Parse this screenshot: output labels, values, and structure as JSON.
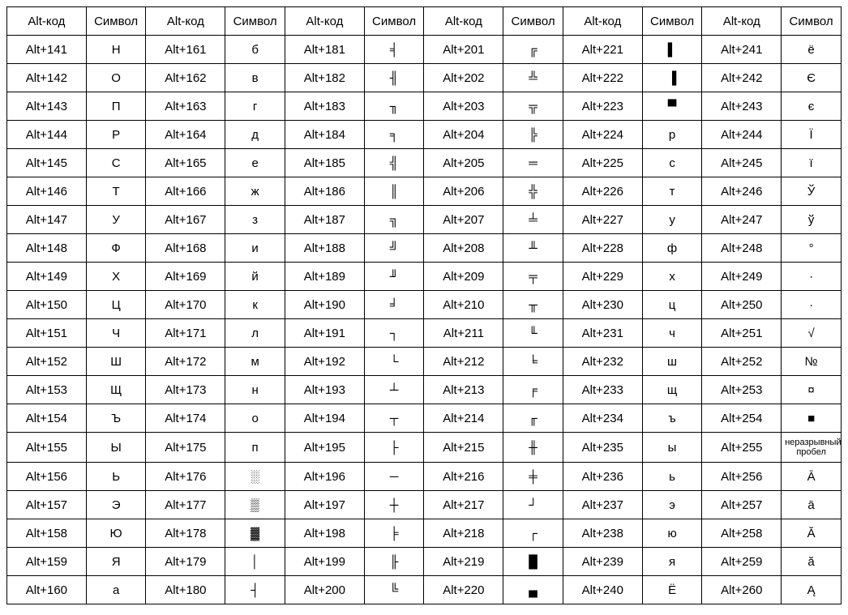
{
  "headers": {
    "code": "Alt-код",
    "symbol": "Символ"
  },
  "columns": [
    [
      {
        "code": "Alt+141",
        "sym": "Н"
      },
      {
        "code": "Alt+142",
        "sym": "О"
      },
      {
        "code": "Alt+143",
        "sym": "П"
      },
      {
        "code": "Alt+144",
        "sym": "Р"
      },
      {
        "code": "Alt+145",
        "sym": "С"
      },
      {
        "code": "Alt+146",
        "sym": "Т"
      },
      {
        "code": "Alt+147",
        "sym": "У"
      },
      {
        "code": "Alt+148",
        "sym": "Ф"
      },
      {
        "code": "Alt+149",
        "sym": "Х"
      },
      {
        "code": "Alt+150",
        "sym": "Ц"
      },
      {
        "code": "Alt+151",
        "sym": "Ч"
      },
      {
        "code": "Alt+152",
        "sym": "Ш"
      },
      {
        "code": "Alt+153",
        "sym": "Щ"
      },
      {
        "code": "Alt+154",
        "sym": "Ъ"
      },
      {
        "code": "Alt+155",
        "sym": "Ы"
      },
      {
        "code": "Alt+156",
        "sym": "Ь"
      },
      {
        "code": "Alt+157",
        "sym": "Э"
      },
      {
        "code": "Alt+158",
        "sym": "Ю"
      },
      {
        "code": "Alt+159",
        "sym": "Я"
      },
      {
        "code": "Alt+160",
        "sym": "а"
      }
    ],
    [
      {
        "code": "Alt+161",
        "sym": "б"
      },
      {
        "code": "Alt+162",
        "sym": "в"
      },
      {
        "code": "Alt+163",
        "sym": "г"
      },
      {
        "code": "Alt+164",
        "sym": "д"
      },
      {
        "code": "Alt+165",
        "sym": "е"
      },
      {
        "code": "Alt+166",
        "sym": "ж"
      },
      {
        "code": "Alt+167",
        "sym": "з"
      },
      {
        "code": "Alt+168",
        "sym": "и"
      },
      {
        "code": "Alt+169",
        "sym": "й"
      },
      {
        "code": "Alt+170",
        "sym": "к"
      },
      {
        "code": "Alt+171",
        "sym": "л"
      },
      {
        "code": "Alt+172",
        "sym": "м"
      },
      {
        "code": "Alt+173",
        "sym": "н"
      },
      {
        "code": "Alt+174",
        "sym": "о"
      },
      {
        "code": "Alt+175",
        "sym": "п"
      },
      {
        "code": "Alt+176",
        "sym": "░"
      },
      {
        "code": "Alt+177",
        "sym": "▒"
      },
      {
        "code": "Alt+178",
        "sym": "▓"
      },
      {
        "code": "Alt+179",
        "sym": "│"
      },
      {
        "code": "Alt+180",
        "sym": "┤"
      }
    ],
    [
      {
        "code": "Alt+181",
        "sym": "╡"
      },
      {
        "code": "Alt+182",
        "sym": "╢"
      },
      {
        "code": "Alt+183",
        "sym": "╖"
      },
      {
        "code": "Alt+184",
        "sym": "╕"
      },
      {
        "code": "Alt+185",
        "sym": "╣"
      },
      {
        "code": "Alt+186",
        "sym": "║"
      },
      {
        "code": "Alt+187",
        "sym": "╗"
      },
      {
        "code": "Alt+188",
        "sym": "╝"
      },
      {
        "code": "Alt+189",
        "sym": "╜"
      },
      {
        "code": "Alt+190",
        "sym": "╛"
      },
      {
        "code": "Alt+191",
        "sym": "┐"
      },
      {
        "code": "Alt+192",
        "sym": "└"
      },
      {
        "code": "Alt+193",
        "sym": "┴"
      },
      {
        "code": "Alt+194",
        "sym": "┬"
      },
      {
        "code": "Alt+195",
        "sym": "├"
      },
      {
        "code": "Alt+196",
        "sym": "─"
      },
      {
        "code": "Alt+197",
        "sym": "┼"
      },
      {
        "code": "Alt+198",
        "sym": "╞"
      },
      {
        "code": "Alt+199",
        "sym": "╟"
      },
      {
        "code": "Alt+200",
        "sym": "╚"
      }
    ],
    [
      {
        "code": "Alt+201",
        "sym": "╔"
      },
      {
        "code": "Alt+202",
        "sym": "╩"
      },
      {
        "code": "Alt+203",
        "sym": "╦"
      },
      {
        "code": "Alt+204",
        "sym": "╠"
      },
      {
        "code": "Alt+205",
        "sym": "═"
      },
      {
        "code": "Alt+206",
        "sym": "╬"
      },
      {
        "code": "Alt+207",
        "sym": "╧"
      },
      {
        "code": "Alt+208",
        "sym": "╨"
      },
      {
        "code": "Alt+209",
        "sym": "╤"
      },
      {
        "code": "Alt+210",
        "sym": "╥"
      },
      {
        "code": "Alt+211",
        "sym": "╙"
      },
      {
        "code": "Alt+212",
        "sym": "╘"
      },
      {
        "code": "Alt+213",
        "sym": "╒"
      },
      {
        "code": "Alt+214",
        "sym": "╓"
      },
      {
        "code": "Alt+215",
        "sym": "╫"
      },
      {
        "code": "Alt+216",
        "sym": "╪"
      },
      {
        "code": "Alt+217",
        "sym": "┘"
      },
      {
        "code": "Alt+218",
        "sym": "┌"
      },
      {
        "code": "Alt+219",
        "sym": "█"
      },
      {
        "code": "Alt+220",
        "sym": "▄"
      }
    ],
    [
      {
        "code": "Alt+221",
        "sym": "▌"
      },
      {
        "code": "Alt+222",
        "sym": "▐"
      },
      {
        "code": "Alt+223",
        "sym": "▀"
      },
      {
        "code": "Alt+224",
        "sym": "р"
      },
      {
        "code": "Alt+225",
        "sym": "с"
      },
      {
        "code": "Alt+226",
        "sym": "т"
      },
      {
        "code": "Alt+227",
        "sym": "у"
      },
      {
        "code": "Alt+228",
        "sym": "ф"
      },
      {
        "code": "Alt+229",
        "sym": "х"
      },
      {
        "code": "Alt+230",
        "sym": "ц"
      },
      {
        "code": "Alt+231",
        "sym": "ч"
      },
      {
        "code": "Alt+232",
        "sym": "ш"
      },
      {
        "code": "Alt+233",
        "sym": "щ"
      },
      {
        "code": "Alt+234",
        "sym": "ъ"
      },
      {
        "code": "Alt+235",
        "sym": "ы"
      },
      {
        "code": "Alt+236",
        "sym": "ь"
      },
      {
        "code": "Alt+237",
        "sym": "э"
      },
      {
        "code": "Alt+238",
        "sym": "ю"
      },
      {
        "code": "Alt+239",
        "sym": "я"
      },
      {
        "code": "Alt+240",
        "sym": "Ё"
      }
    ],
    [
      {
        "code": "Alt+241",
        "sym": "ё"
      },
      {
        "code": "Alt+242",
        "sym": "Є"
      },
      {
        "code": "Alt+243",
        "sym": "є"
      },
      {
        "code": "Alt+244",
        "sym": "Ї"
      },
      {
        "code": "Alt+245",
        "sym": "ї"
      },
      {
        "code": "Alt+246",
        "sym": "Ў"
      },
      {
        "code": "Alt+247",
        "sym": "ў"
      },
      {
        "code": "Alt+248",
        "sym": "°"
      },
      {
        "code": "Alt+249",
        "sym": "∙"
      },
      {
        "code": "Alt+250",
        "sym": "·"
      },
      {
        "code": "Alt+251",
        "sym": "√"
      },
      {
        "code": "Alt+252",
        "sym": "№"
      },
      {
        "code": "Alt+253",
        "sym": "¤"
      },
      {
        "code": "Alt+254",
        "sym": "■"
      },
      {
        "code": "Alt+255",
        "sym": "неразрывный пробел",
        "small": true
      },
      {
        "code": "Alt+256",
        "sym": "Ā"
      },
      {
        "code": "Alt+257",
        "sym": "ā"
      },
      {
        "code": "Alt+258",
        "sym": "Ă"
      },
      {
        "code": "Alt+259",
        "sym": "ă"
      },
      {
        "code": "Alt+260",
        "sym": "Ą"
      }
    ]
  ]
}
